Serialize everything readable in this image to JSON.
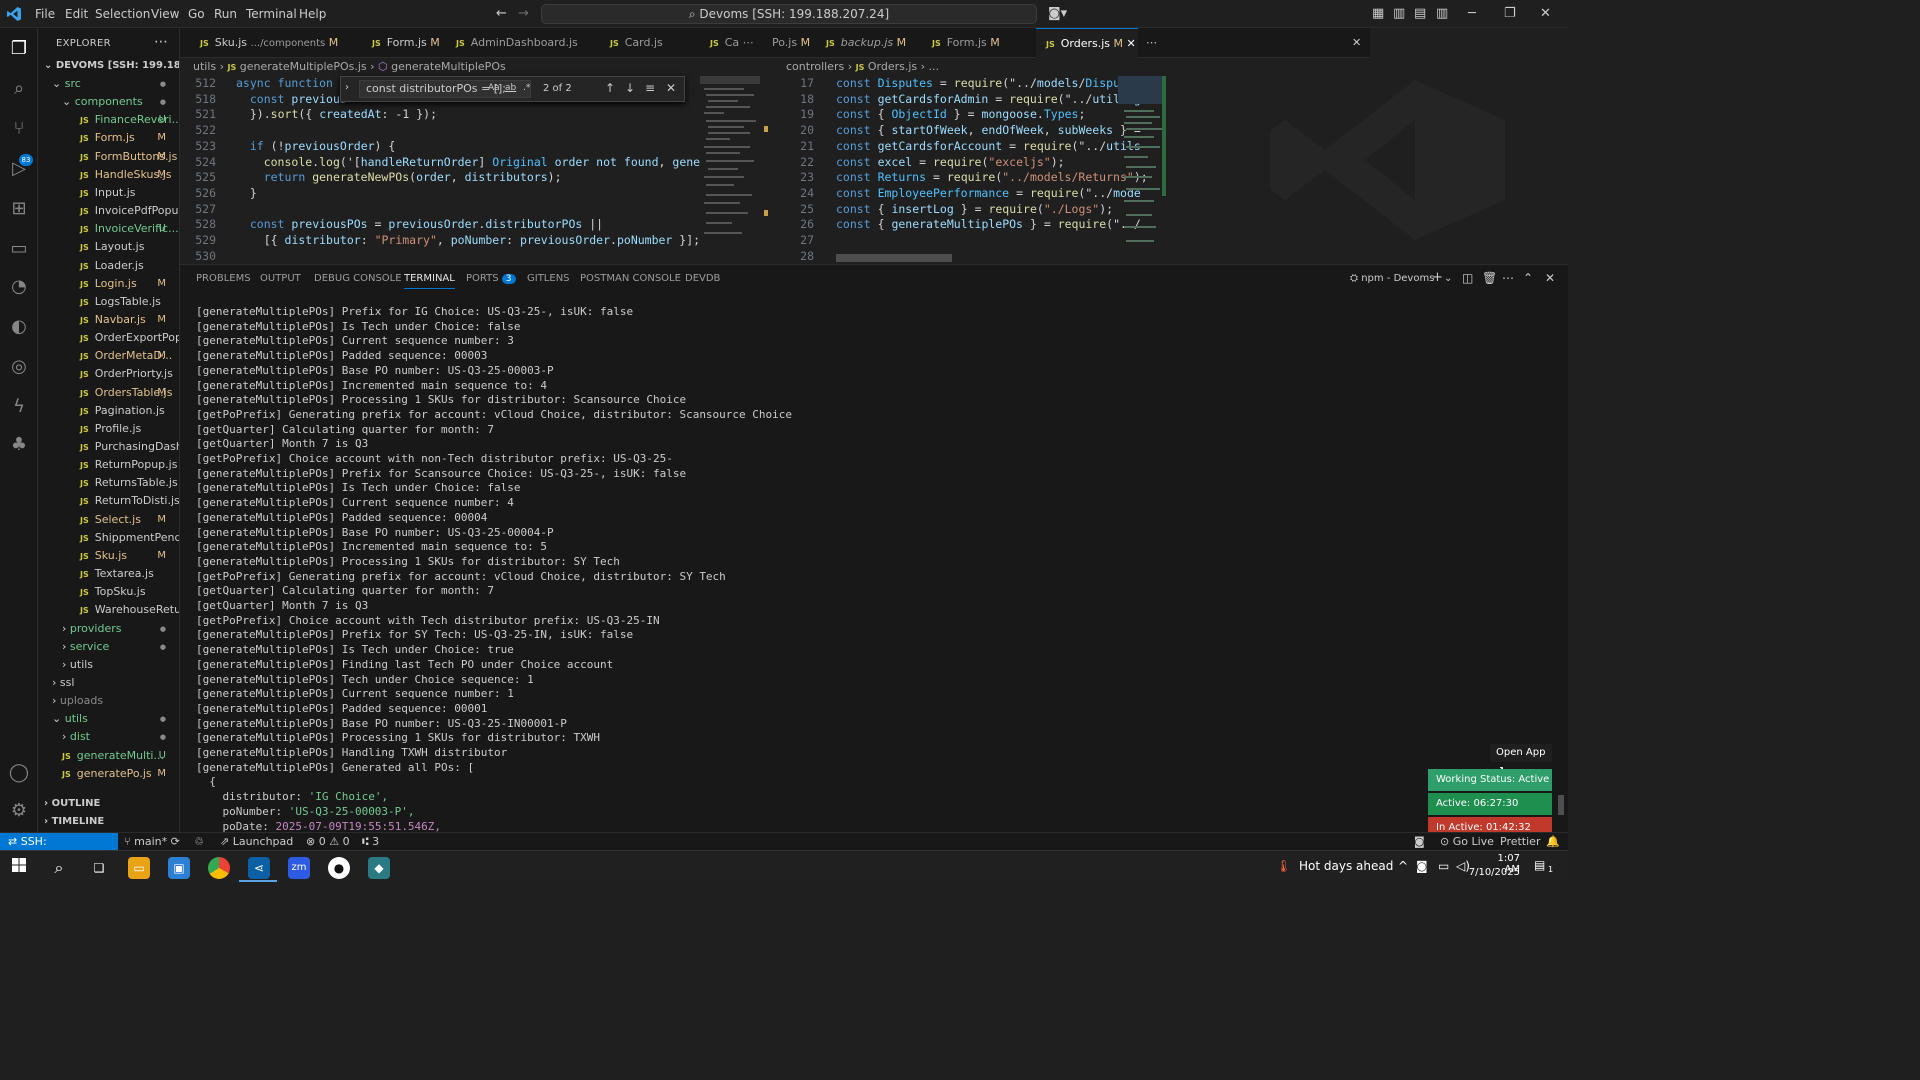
{
  "menu": [
    "File",
    "Edit",
    "Selection",
    "View",
    "Go",
    "Run",
    "Terminal",
    "Help"
  ],
  "command_center": "Devoms [SSH: 199.188.207.24]",
  "explorer": {
    "title": "EXPLORER",
    "root": "DEVOMS [SSH: 199.188.20...",
    "items": [
      {
        "label": "src",
        "kind": "folder",
        "status": "dot"
      },
      {
        "label": "components",
        "kind": "folder",
        "status": "dot"
      },
      {
        "label": "FinanceReveri...",
        "kind": "js",
        "status": "U"
      },
      {
        "label": "Form.js",
        "kind": "js",
        "status": "M"
      },
      {
        "label": "FormButtons.js",
        "kind": "js",
        "status": "M"
      },
      {
        "label": "HandleSkus.js",
        "kind": "js",
        "status": "M"
      },
      {
        "label": "Input.js",
        "kind": "js",
        "status": ""
      },
      {
        "label": "InvoicePdfPopup.js",
        "kind": "js",
        "status": ""
      },
      {
        "label": "InvoiceVerific...",
        "kind": "js",
        "status": "U"
      },
      {
        "label": "Layout.js",
        "kind": "js",
        "status": ""
      },
      {
        "label": "Loader.js",
        "kind": "js",
        "status": ""
      },
      {
        "label": "Login.js",
        "kind": "js",
        "status": "M"
      },
      {
        "label": "LogsTable.js",
        "kind": "js",
        "status": ""
      },
      {
        "label": "Navbar.js",
        "kind": "js",
        "status": "M"
      },
      {
        "label": "OrderExportPopup.js",
        "kind": "js",
        "status": ""
      },
      {
        "label": "OrderMetaD...",
        "kind": "js",
        "status": "M"
      },
      {
        "label": "OrderPriorty.js",
        "kind": "js",
        "status": ""
      },
      {
        "label": "OrdersTable.js",
        "kind": "js",
        "status": "M"
      },
      {
        "label": "Pagination.js",
        "kind": "js",
        "status": ""
      },
      {
        "label": "Profile.js",
        "kind": "js",
        "status": ""
      },
      {
        "label": "PurchasingDashbo...",
        "kind": "js",
        "status": ""
      },
      {
        "label": "ReturnPopup.js",
        "kind": "js",
        "status": ""
      },
      {
        "label": "ReturnsTable.js",
        "kind": "js",
        "status": ""
      },
      {
        "label": "ReturnToDisti.js",
        "kind": "js",
        "status": ""
      },
      {
        "label": "Select.js",
        "kind": "js",
        "status": "M"
      },
      {
        "label": "ShippmentPending...",
        "kind": "js",
        "status": ""
      },
      {
        "label": "Sku.js",
        "kind": "js",
        "status": "M"
      },
      {
        "label": "Textarea.js",
        "kind": "js",
        "status": ""
      },
      {
        "label": "TopSku.js",
        "kind": "js",
        "status": ""
      },
      {
        "label": "WarehouseReturn.js",
        "kind": "js",
        "status": ""
      },
      {
        "label": "providers",
        "kind": "folder",
        "status": "dot"
      },
      {
        "label": "service",
        "kind": "folder",
        "status": "dot"
      },
      {
        "label": "utils",
        "kind": "folder",
        "status": ""
      },
      {
        "label": "ssl",
        "kind": "folder",
        "status": ""
      },
      {
        "label": "uploads",
        "kind": "folder",
        "status": ""
      },
      {
        "label": "utils",
        "kind": "folder",
        "status": "dot"
      },
      {
        "label": "dist",
        "kind": "folder",
        "status": "dot"
      },
      {
        "label": "generateMulti...",
        "kind": "js",
        "status": "U"
      },
      {
        "label": "generatePo.js",
        "kind": "js",
        "status": "M"
      }
    ],
    "outline": "OUTLINE",
    "timeline": "TIMELINE"
  },
  "tabs": [
    {
      "label": "Sku.js",
      "desc": ".../components",
      "status": "M"
    },
    {
      "label": "Form.js",
      "status": "M"
    },
    {
      "label": "AdminDashboard.js",
      "status": ""
    },
    {
      "label": "Card.js",
      "status": ""
    },
    {
      "label": "Ca",
      "status": ""
    },
    {
      "label": "Po.js",
      "status": "M"
    },
    {
      "label": "backup.js",
      "status": "M"
    },
    {
      "label": "Form.js",
      "status": "M"
    },
    {
      "label": "Orders.js",
      "status": "M"
    }
  ],
  "left_editor": {
    "breadcrumb": [
      "utils",
      "generateMultiplePOs.js",
      "generateMultiplePOs"
    ],
    "find": {
      "query": "const distributorPOs = [];",
      "count": "2 of 2",
      "aa": "Aa",
      "ab": "ab",
      "regex": ".*"
    },
    "lines": [
      {
        "n": "512",
        "t": "async function h"
      },
      {
        "n": "518",
        "t": "  const previous"
      },
      {
        "n": "521",
        "t": "  }).sort({ createdAt: -1 });"
      },
      {
        "n": "522",
        "t": ""
      },
      {
        "n": "523",
        "t": "  if (!previousOrder) {"
      },
      {
        "n": "524",
        "t": "    console.log('[handleReturnOrder] Original order not found, generatin"
      },
      {
        "n": "525",
        "t": "    return generateNewPOs(order, distributors);"
      },
      {
        "n": "526",
        "t": "  }"
      },
      {
        "n": "527",
        "t": ""
      },
      {
        "n": "528",
        "t": "  const previousPOs = previousOrder.distributorPOs ||"
      },
      {
        "n": "529",
        "t": "    [{ distributor: \"Primary\", poNumber: previousOrder.poNumber }];"
      },
      {
        "n": "530",
        "t": ""
      }
    ]
  },
  "right_editor": {
    "breadcrumb": [
      "controllers",
      "Orders.js",
      "..."
    ],
    "lines": [
      {
        "n": "17",
        "t": "const Disputes = require(\"../models/Disputes"
      },
      {
        "n": "18",
        "t": "const getCardsforAdmin = require(\"../utils/g"
      },
      {
        "n": "19",
        "t": "const { ObjectId } = mongoose.Types;"
      },
      {
        "n": "20",
        "t": "const { startOfWeek, endOfWeek, subWeeks } ="
      },
      {
        "n": "21",
        "t": "const getCardsforAccount = require(\"../utils"
      },
      {
        "n": "22",
        "t": "const excel = require(\"exceljs\");"
      },
      {
        "n": "23",
        "t": "const Returns = require(\"../models/Returns\");"
      },
      {
        "n": "24",
        "t": "const EmployeePerformance = require(\"../mode"
      },
      {
        "n": "25",
        "t": "const { insertLog } = require(\"./Logs\");"
      },
      {
        "n": "26",
        "t": "const { generateMultiplePOs } = require(\"../"
      },
      {
        "n": "27",
        "t": ""
      },
      {
        "n": "28",
        "t": ""
      }
    ]
  },
  "panel": {
    "tabs": [
      "PROBLEMS",
      "OUTPUT",
      "DEBUG CONSOLE",
      "TERMINAL",
      "PORTS",
      "GITLENS",
      "POSTMAN CONSOLE",
      "DEVDB"
    ],
    "ports_badge": "3",
    "terminal_name": "npm - Devoms",
    "lines": [
      "[generateMultiplePOs] Prefix for IG Choice: US-Q3-25-, isUK: false",
      "[generateMultiplePOs] Is Tech under Choice: false",
      "[generateMultiplePOs] Current sequence number: 3",
      "[generateMultiplePOs] Padded sequence: 00003",
      "[generateMultiplePOs] Base PO number: US-Q3-25-00003-P",
      "[generateMultiplePOs] Incremented main sequence to: 4",
      "[generateMultiplePOs] Processing 1 SKUs for distributor: Scansource Choice",
      "[getPoPrefix] Generating prefix for account: vCloud Choice, distributor: Scansource Choice",
      "[getQuarter] Calculating quarter for month: 7",
      "[getQuarter] Month 7 is Q3",
      "[getPoPrefix] Choice account with non-Tech distributor prefix: US-Q3-25-",
      "[generateMultiplePOs] Prefix for Scansource Choice: US-Q3-25-, isUK: false",
      "[generateMultiplePOs] Is Tech under Choice: false",
      "[generateMultiplePOs] Current sequence number: 4",
      "[generateMultiplePOs] Padded sequence: 00004",
      "[generateMultiplePOs] Base PO number: US-Q3-25-00004-P",
      "[generateMultiplePOs] Incremented main sequence to: 5",
      "[generateMultiplePOs] Processing 1 SKUs for distributor: SY Tech",
      "[getPoPrefix] Generating prefix for account: vCloud Choice, distributor: SY Tech",
      "[getQuarter] Calculating quarter for month: 7",
      "[getQuarter] Month 7 is Q3",
      "[getPoPrefix] Choice account with Tech distributor prefix: US-Q3-25-IN",
      "[generateMultiplePOs] Prefix for SY Tech: US-Q3-25-IN, isUK: false",
      "[generateMultiplePOs] Is Tech under Choice: true",
      "[generateMultiplePOs] Finding last Tech PO under Choice account",
      "[generateMultiplePOs] Tech under Choice sequence: 1",
      "[generateMultiplePOs] Current sequence number: 1",
      "[generateMultiplePOs] Padded sequence: 00001",
      "[generateMultiplePOs] Base PO number: US-Q3-25-IN00001-P",
      "[generateMultiplePOs] Processing 1 SKUs for distributor: TXWH",
      "[generateMultiplePOs] Handling TXWH distributor",
      "[generateMultiplePOs] Generated all POs: ["
    ],
    "obj": {
      "open": "  {",
      "k1": "    distributor: ",
      "v1": "'IG Choice',",
      "k2": "    poNumber: ",
      "v2": "'US-Q3-25-00003-P',",
      "k3": "    poDate: ",
      "v3": "2025-07-09T19:55:51.546Z,"
    }
  },
  "widgets": {
    "open_app": "Open App ↗",
    "working": "Working Status: Active",
    "active": "Active: 06:27:30",
    "inactive": "In Active: 01:42:32"
  },
  "status": {
    "remote": "SSH: 199.188.207.24",
    "branch": "main*",
    "launchpad": "Launchpad",
    "errors": "0",
    "warnings": "0",
    "ports": "3",
    "golive": "Go Live",
    "prettier": "Prettier"
  },
  "taskbar": {
    "weather": "Hot days ahead",
    "time": "1:07 AM",
    "date": "7/10/2025",
    "notif": "1"
  },
  "colors": {
    "accent": "#0078d4",
    "working": "#2e9e6b",
    "active": "#1f8f4f",
    "inactive": "#c0392b"
  }
}
